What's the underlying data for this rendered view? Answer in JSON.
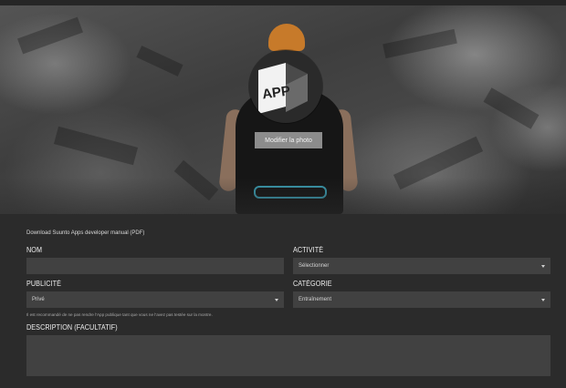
{
  "hero": {
    "app_icon_text": "APP",
    "modify_photo_label": "Modifier la photo"
  },
  "manual_link": "Download Suunto Apps developer manual (PDF)",
  "form": {
    "name": {
      "label": "NOM",
      "value": ""
    },
    "activity": {
      "label": "ACTIVITÉ",
      "selected": "Sélectionner"
    },
    "publicity": {
      "label": "PUBLICITÉ",
      "selected": "Privé",
      "hint": "Il est recommandé de ne pas rendre l'App publique tant que vous ne l'avez pas testée sur la montre."
    },
    "category": {
      "label": "CATÉGORIE",
      "selected": "Entraînement"
    },
    "description": {
      "label": "DESCRIPTION (FACULTATIF)",
      "value": ""
    }
  },
  "colors": {
    "page_background": "#2b2b2b",
    "field_background": "#414141",
    "button_background": "#8c8c8c",
    "text": "#f0f0f0"
  },
  "icons": [
    "app-logo-icon",
    "chevron-down-icon"
  ]
}
